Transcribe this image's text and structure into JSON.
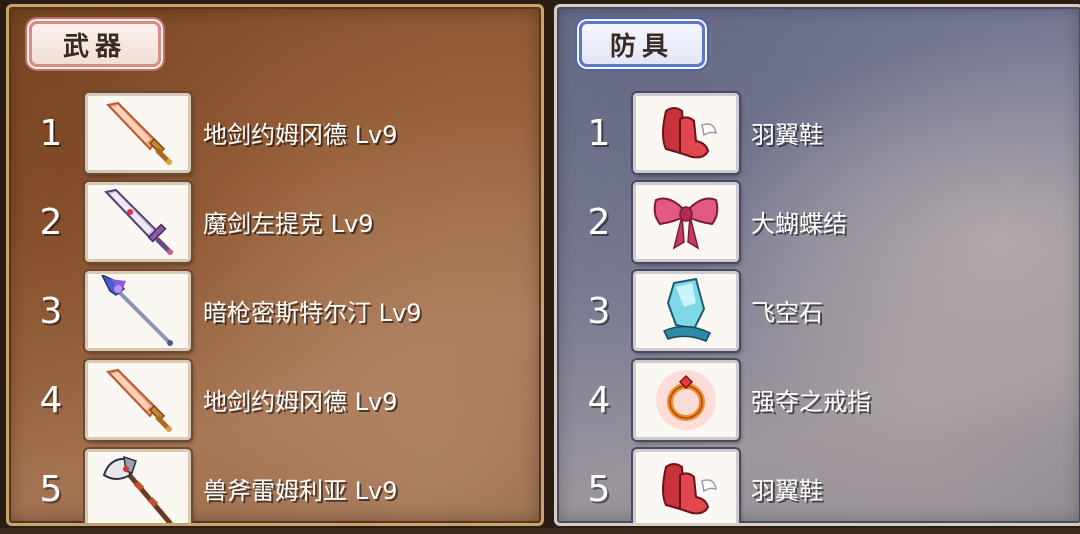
{
  "weapons": {
    "tab_label": "武器",
    "items": [
      {
        "num": "1",
        "name": "地剑约姆冈德 Lv9",
        "icon": "earth-sword-icon"
      },
      {
        "num": "2",
        "name": "魔剑左提克 Lv9",
        "icon": "demon-sword-icon"
      },
      {
        "num": "3",
        "name": "暗枪密斯特尔汀 Lv9",
        "icon": "dark-spear-icon"
      },
      {
        "num": "4",
        "name": "地剑约姆冈德 Lv9",
        "icon": "earth-sword-icon"
      },
      {
        "num": "5",
        "name": "兽斧雷姆利亚 Lv9",
        "icon": "beast-axe-icon"
      }
    ]
  },
  "armor": {
    "tab_label": "防具",
    "items": [
      {
        "num": "1",
        "name": "羽翼鞋",
        "icon": "winged-boots-icon"
      },
      {
        "num": "2",
        "name": "大蝴蝶结",
        "icon": "big-bow-icon"
      },
      {
        "num": "3",
        "name": "飞空石",
        "icon": "levistone-icon"
      },
      {
        "num": "4",
        "name": "强夺之戒指",
        "icon": "plunder-ring-icon"
      },
      {
        "num": "5",
        "name": "羽翼鞋",
        "icon": "winged-boots-icon"
      }
    ]
  },
  "colors": {
    "weapon_panel": "#96603a",
    "armor_panel": "#828399",
    "weapon_tag_border": "#d98b86",
    "armor_tag_border": "#5d77c7",
    "text": "#ffffff"
  }
}
